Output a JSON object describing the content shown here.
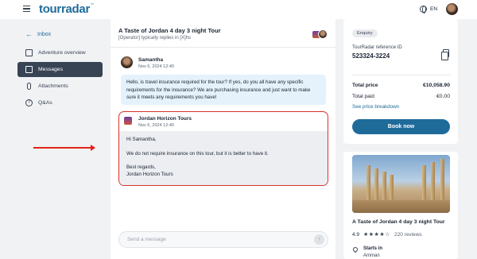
{
  "header": {
    "logo_text": "tourradar",
    "logo_mark": "™",
    "language": "EN"
  },
  "sidebar": {
    "back_label": "Inbox",
    "items": [
      {
        "label": "Adventure overview",
        "icon": "clipboard-icon",
        "active": false
      },
      {
        "label": "Messages",
        "icon": "chat-icon",
        "active": true
      },
      {
        "label": "Attachments",
        "icon": "paperclip-icon",
        "active": false
      },
      {
        "label": "Q&As",
        "icon": "question-icon",
        "active": false
      }
    ]
  },
  "conversation": {
    "title": "A Taste of Jordan 4 day 3 night Tour",
    "subtitle": "[Operator] typically replies in [X]hs",
    "messages": [
      {
        "sender": "Samantha",
        "date": "Nov 6, 2024 12:40",
        "text": "Hello, is travel insurance required for the tour? If yes, do you all have any specific requirements for the insurance? We are purchasing insurance and just want to make sure it meets any requirements you have!"
      },
      {
        "sender": "Jordan Horizon Tours",
        "date": "Nov 6, 2024 12:40",
        "lines": [
          "Hi Samantha,",
          "We do not require insurance on this tour, but it is better to have it.",
          "Best regards,",
          "Jordan Horizon Tours"
        ]
      }
    ],
    "input_placeholder": "Send a message"
  },
  "booking": {
    "status_badge": "Enquiry",
    "ref_label": "TourRadar reference ID",
    "ref_id": "523324-3224",
    "total_price_label": "Total price",
    "total_price": "€10,058.90",
    "total_paid_label": "Total paid",
    "total_paid": "€0.00",
    "breakdown_link": "See price breakdown",
    "book_button": "Book now"
  },
  "tour": {
    "name": "A Taste of Jordan 4 day 3 night Tour",
    "rating": "4.9",
    "stars": "★★★★☆",
    "rating_value": 4.9,
    "reviews": "220 reviews",
    "starts_label": "Starts in",
    "starts_value": "Amman"
  },
  "colors": {
    "accent": "#1e6b9a",
    "highlight_border": "#d9332b",
    "annotation_arrow": "#e2231a",
    "active_nav": "#384354"
  }
}
